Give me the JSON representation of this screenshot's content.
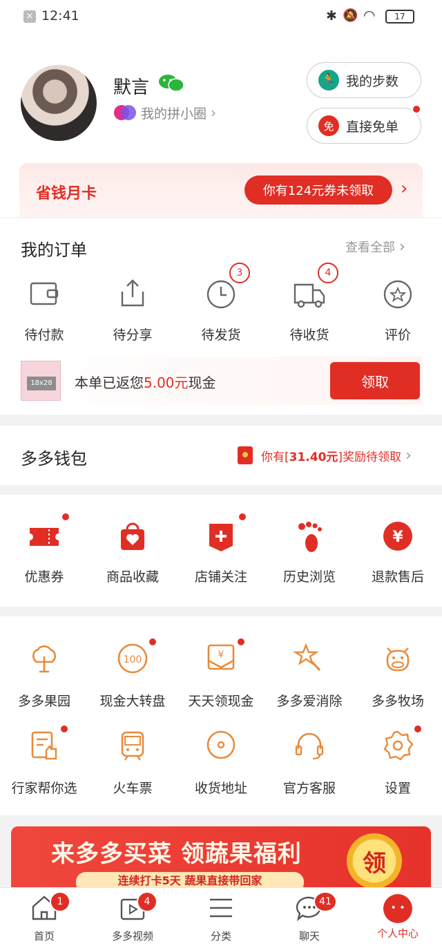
{
  "status": {
    "time": "12:41",
    "battery": "17"
  },
  "profile": {
    "name": "默言",
    "circle_label": "我的拼小圈"
  },
  "actions": {
    "steps": "我的步数",
    "free_order": "直接免单"
  },
  "savings_card": {
    "title": "省钱月卡",
    "coupon_text": "你有124元券未领取"
  },
  "orders": {
    "title": "我的订单",
    "view_all": "查看全部",
    "items": [
      {
        "label": "待付款",
        "icon": "wallet-icon"
      },
      {
        "label": "待分享",
        "icon": "share-icon"
      },
      {
        "label": "待发货",
        "icon": "clock-icon",
        "badge": "3"
      },
      {
        "label": "待收货",
        "icon": "truck-icon",
        "badge": "4"
      },
      {
        "label": "评价",
        "icon": "review-icon"
      }
    ],
    "refund": {
      "thumb_text": "18x28",
      "prefix": "本单已返您",
      "amount": "5.00元",
      "suffix": "现金",
      "button": "领取"
    }
  },
  "wallet": {
    "title": "多多钱包",
    "reward_prefix": "你有[",
    "reward_amount": "31.40元",
    "reward_suffix": "]奖励待领取"
  },
  "shortcuts": [
    {
      "label": "优惠券",
      "icon": "coupon-icon",
      "dot": true
    },
    {
      "label": "商品收藏",
      "icon": "favorite-bag-icon",
      "dot": false
    },
    {
      "label": "店铺关注",
      "icon": "store-follow-icon",
      "dot": true
    },
    {
      "label": "历史浏览",
      "icon": "footprint-icon",
      "dot": false
    },
    {
      "label": "退款售后",
      "icon": "refund-icon",
      "dot": false
    }
  ],
  "services_row1": [
    {
      "label": "多多果园",
      "icon": "tree-icon",
      "dot": false
    },
    {
      "label": "现金大转盘",
      "icon": "wheel-icon",
      "dot": true
    },
    {
      "label": "天天领现金",
      "icon": "cash-envelope-icon",
      "dot": true
    },
    {
      "label": "多多爱消除",
      "icon": "star-wand-icon",
      "dot": false
    },
    {
      "label": "多多牧场",
      "icon": "cow-icon",
      "dot": false
    }
  ],
  "services_row2": [
    {
      "label": "行家帮你选",
      "icon": "expert-pick-icon",
      "dot": true
    },
    {
      "label": "火车票",
      "icon": "train-icon",
      "dot": false
    },
    {
      "label": "收货地址",
      "icon": "location-icon",
      "dot": false
    },
    {
      "label": "官方客服",
      "icon": "headset-icon",
      "dot": false
    },
    {
      "label": "设置",
      "icon": "settings-icon",
      "dot": true
    }
  ],
  "banner": {
    "title": "来多多买菜 领蔬果福利",
    "subtitle": "连续打卡5天 蔬果直接带回家",
    "badge": "领"
  },
  "nav": [
    {
      "label": "首页",
      "badge": "1",
      "icon": "home-icon"
    },
    {
      "label": "多多视频",
      "badge": "4",
      "icon": "video-icon"
    },
    {
      "label": "分类",
      "badge": "",
      "icon": "list-icon"
    },
    {
      "label": "聊天",
      "badge": "41",
      "icon": "chat-icon"
    },
    {
      "label": "个人中心",
      "badge": "",
      "icon": "profile-icon"
    }
  ],
  "colors": {
    "accent": "#e02e24",
    "orange": "#e98a3a"
  }
}
